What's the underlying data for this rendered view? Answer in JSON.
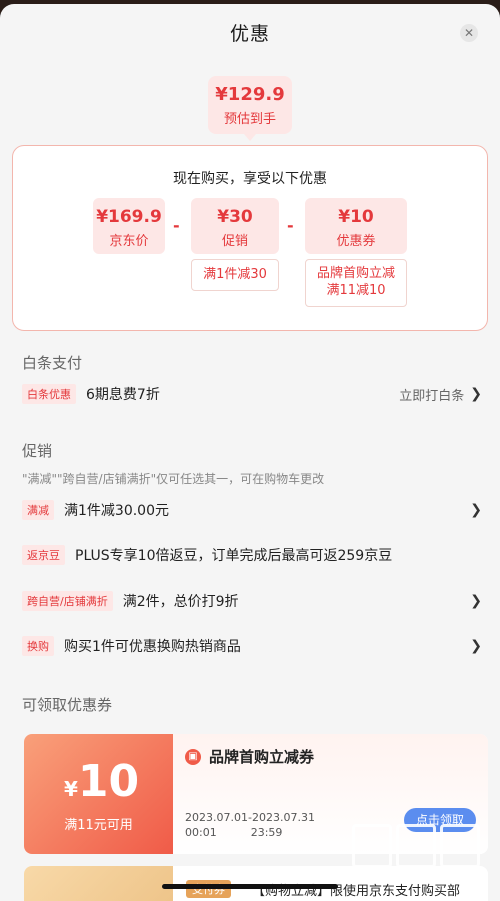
{
  "header": {
    "title": "优惠"
  },
  "estimate": {
    "price": "¥129.9",
    "label": "预估到手"
  },
  "breakdown": {
    "heading": "现在购买，享受以下优惠",
    "items": [
      {
        "value": "¥169.9",
        "label": "京东价"
      },
      {
        "value": "¥30",
        "label": "促销"
      },
      {
        "value": "¥10",
        "label": "优惠券"
      }
    ],
    "op1": "-",
    "op2": "-",
    "promo_detail": "满1件减30",
    "coupon_detail_1": "品牌首购立减",
    "coupon_detail_2": "满11减10"
  },
  "baitiao": {
    "title": "白条支付",
    "tag": "白条优惠",
    "text": "6期息费7折",
    "action": "立即打白条"
  },
  "promotions": {
    "title": "促销",
    "note": "\"满减\"\"跨自营/店铺满折\"仅可任选其一，可在购物车更改",
    "items": [
      {
        "tag": "满减",
        "text": "满1件减30.00元"
      },
      {
        "tag": "返京豆",
        "text": "PLUS专享10倍返豆，订单完成后最高可返259京豆"
      },
      {
        "tag": "跨自营/店铺满折",
        "text": "满2件，总价打9折"
      },
      {
        "tag": "换购",
        "text": "购买1件可优惠换购热销商品"
      }
    ]
  },
  "coupons": {
    "title": "可领取优惠券",
    "first": {
      "yen": "¥",
      "amount": "10",
      "condition": "满11元可用",
      "name": "品牌首购立减券",
      "date_start": "2023.07.01",
      "time_start": "00:01",
      "date_end": "2023.07.31",
      "time_end": "23:59",
      "claim": "点击领取"
    },
    "second": {
      "badge": "支付券",
      "text": "【购物立减】限使用京东支付购买部"
    }
  }
}
